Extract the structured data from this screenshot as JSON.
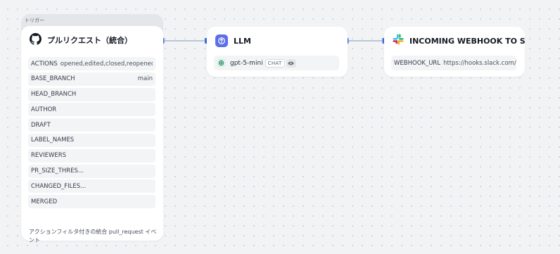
{
  "trigger": {
    "group_label": "トリガー",
    "title": "プルリクエスト（統合）",
    "icon": "github-icon",
    "params": [
      {
        "name": "ACTIONS",
        "value": "opened,edited,closed,reopened"
      },
      {
        "name": "BASE_BRANCH",
        "value": "main"
      },
      {
        "name": "HEAD_BRANCH",
        "value": ""
      },
      {
        "name": "AUTHOR",
        "value": ""
      },
      {
        "name": "DRAFT",
        "value": ""
      },
      {
        "name": "LABEL_NAMES",
        "value": ""
      },
      {
        "name": "REVIEWERS",
        "value": ""
      },
      {
        "name": "PR_SIZE_THRES...",
        "value": ""
      },
      {
        "name": "CHANGED_FILES...",
        "value": ""
      },
      {
        "name": "MERGED",
        "value": ""
      }
    ],
    "description": "アクションフィルタ付きの統合 pull_request イベント"
  },
  "llm": {
    "title": "LLM",
    "icon": "llm-icon",
    "model": "gpt-5-mini",
    "model_icon": "openai-icon",
    "badge": "CHAT",
    "badge_icon": "eye-icon"
  },
  "slack": {
    "title": "INCOMING WEBHOOK TO SEND",
    "icon": "slack-icon",
    "param_name": "WEBHOOK_URL",
    "param_value": "https://hooks.slack.com/services/"
  },
  "colors": {
    "canvas": "#f2f3f5",
    "edge": "#aab8cf",
    "handle": "#3d6fe0",
    "llm_accent": "#5c6fe8"
  }
}
